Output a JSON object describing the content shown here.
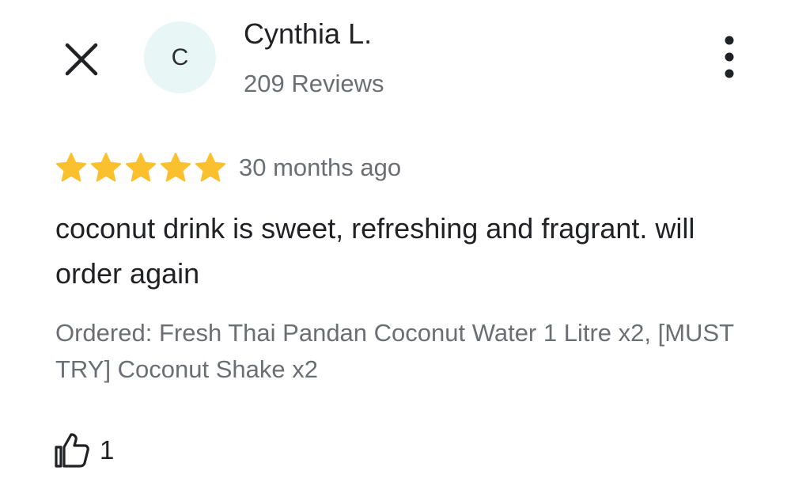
{
  "header": {
    "close_icon": "close-icon",
    "more_icon": "more-vertical-icon"
  },
  "reviewer": {
    "avatar_initial": "C",
    "avatar_bg_color": "#e8f6f5",
    "name": "Cynthia L.",
    "review_count": "209 Reviews"
  },
  "review": {
    "rating": 5,
    "max_rating": 5,
    "star_color": "#fbc02d",
    "time_ago": "30 months ago",
    "text": "coconut drink is sweet, refreshing and fragrant. will order again",
    "ordered": "Ordered: Fresh Thai Pandan Coconut Water 1 Litre x2, [MUST TRY] Coconut Shake x2"
  },
  "actions": {
    "like_icon": "thumbs-up-icon",
    "like_count": "1"
  }
}
